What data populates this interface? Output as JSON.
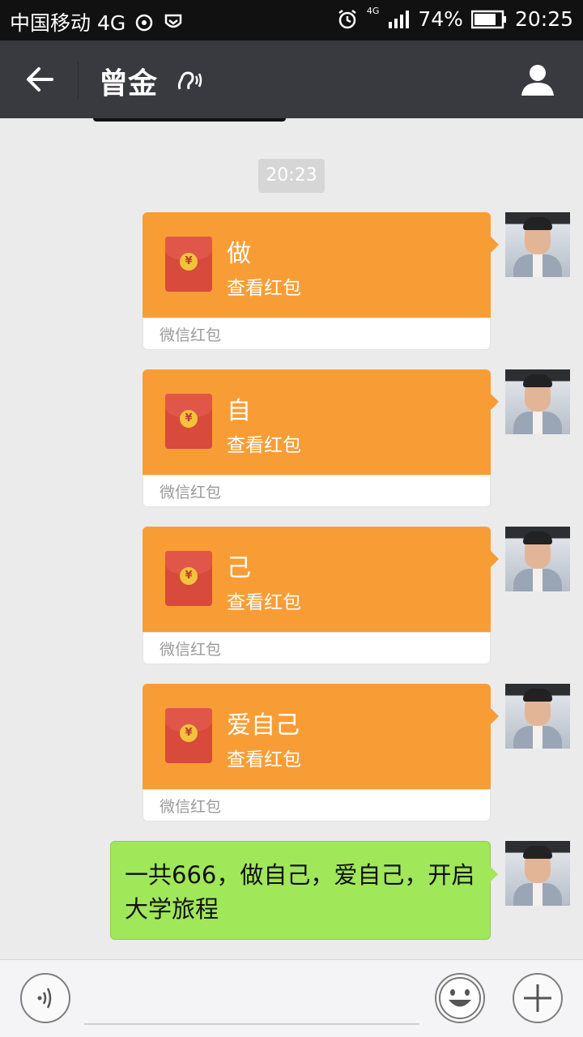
{
  "status_bar": {
    "carrier": "中国移动 4G",
    "network_small": "4G",
    "battery": "74%",
    "time": "20:25"
  },
  "title_bar": {
    "title": "曾金"
  },
  "chat": {
    "timestamp": "20:23",
    "red_packets": [
      {
        "title": "做",
        "action": "查看红包",
        "label": "微信红包"
      },
      {
        "title": "自",
        "action": "查看红包",
        "label": "微信红包"
      },
      {
        "title": "己",
        "action": "查看红包",
        "label": "微信红包"
      },
      {
        "title": "爱自己",
        "action": "查看红包",
        "label": "微信红包"
      }
    ],
    "text_message": "一共666，做自己，爱自己，开启大学旅程"
  },
  "colors": {
    "title_bar_bg": "#393a3f",
    "red_packet_orange": "#f89d36",
    "sent_bubble_green": "#a0e75a",
    "chat_bg": "#ebebeb"
  },
  "icons": {
    "back": "back-arrow-icon",
    "ear": "earpiece-mode-icon",
    "profile": "user-profile-icon",
    "voice": "voice-input-icon",
    "emoji": "emoji-icon",
    "more": "plus-icon"
  }
}
